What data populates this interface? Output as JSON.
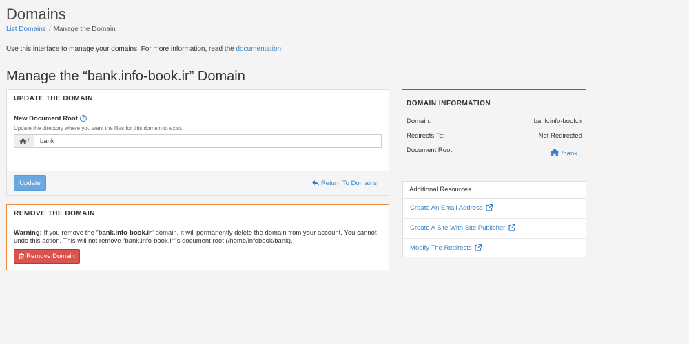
{
  "header": {
    "title": "Domains",
    "breadcrumb": [
      {
        "label": "List Domains"
      },
      {
        "label": "Manage the Domain"
      }
    ],
    "breadcrumb_separator": "/",
    "intro_text": "Use this interface to manage your domains. For more information, read the ",
    "intro_link": "documentation",
    "intro_end": "."
  },
  "manage_title": "Manage the “bank.info-book.ir” Domain",
  "update_panel": {
    "heading": "UPDATE THE DOMAIN",
    "field_label": "New Document Root",
    "help_glyph": "?",
    "hint": "Update the directory where you want the files for this domain to exist.",
    "prefix": "/",
    "value": "bank",
    "update_button": "Update",
    "return_link": "Return To Domains"
  },
  "remove_panel": {
    "heading": "REMOVE THE DOMAIN",
    "warning_label": "Warning:",
    "warning_pre": " If you remove the “",
    "warning_domain": "bank.info-book.ir",
    "warning_post": "” domain, it will permanently delete the domain from your account. You cannot undo this action. This will not remove “bank.info-book.ir”’s document root (/home/infobook/bank).",
    "remove_button": "Remove Domain"
  },
  "info_panel": {
    "heading": "DOMAIN INFORMATION",
    "rows": [
      {
        "label": "Domain:",
        "value": "bank.info-book.ir"
      },
      {
        "label": "Redirects To:",
        "value": "Not Redirected"
      },
      {
        "label": "Document Root:",
        "value": "/bank"
      }
    ]
  },
  "resources_panel": {
    "heading": "Additional Resources",
    "items": [
      {
        "label": "Create An Email Address"
      },
      {
        "label": "Create A Site With Site Publisher"
      },
      {
        "label": "Modify The Redirects"
      }
    ]
  },
  "colors": {
    "link": "#3a80c9",
    "update_button": "#6ca8e0",
    "remove_button": "#d9534f",
    "remove_border": "#f0883c"
  }
}
